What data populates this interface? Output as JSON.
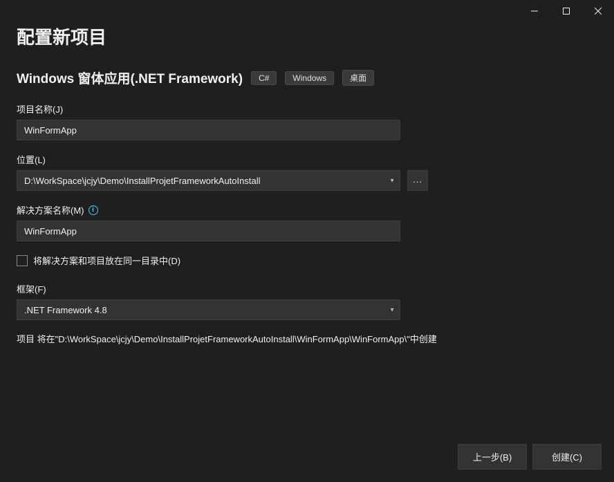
{
  "window": {
    "title": ""
  },
  "page": {
    "title": "配置新项目",
    "template_name": "Windows 窗体应用(.NET Framework)",
    "tags": [
      "C#",
      "Windows",
      "桌面"
    ]
  },
  "fields": {
    "project_name": {
      "label": "项目名称(J)",
      "value": "WinFormApp"
    },
    "location": {
      "label": "位置(L)",
      "value": "D:\\WorkSpace\\jcjy\\Demo\\InstallProjetFrameworkAutoInstall",
      "browse_label": "..."
    },
    "solution_name": {
      "label": "解决方案名称(M)",
      "value": "WinFormApp"
    },
    "same_directory": {
      "label": "将解决方案和项目放在同一目录中(D)",
      "checked": false
    },
    "framework": {
      "label": "框架(F)",
      "value": ".NET Framework 4.8"
    }
  },
  "info": {
    "path_text": "项目 将在\"D:\\WorkSpace\\jcjy\\Demo\\InstallProjetFrameworkAutoInstall\\WinFormApp\\WinFormApp\\\"中创建"
  },
  "footer": {
    "back_label": "上一步(B)",
    "create_label": "创建(C)"
  }
}
